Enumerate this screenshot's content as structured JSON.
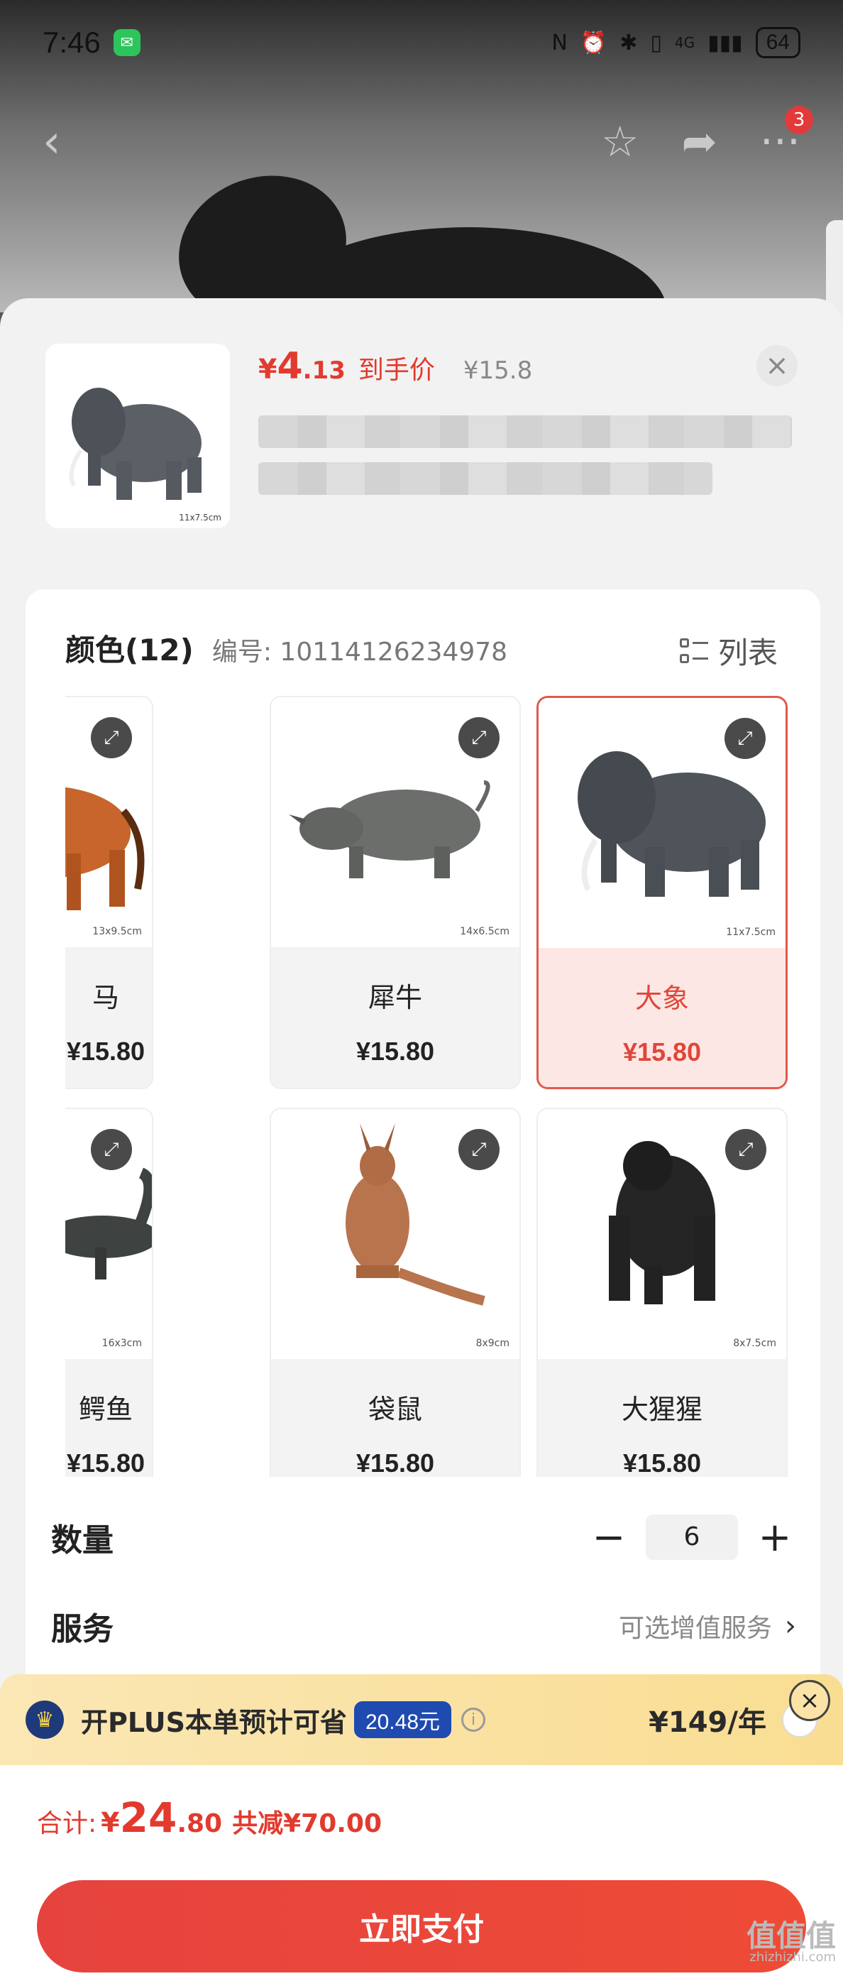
{
  "status": {
    "time": "7:46",
    "battery": "64",
    "network": "4G"
  },
  "nav": {
    "more_badge": "3"
  },
  "product": {
    "price_symbol": "¥",
    "price_int": "4",
    "price_dec": ".13",
    "price_tag": "到手价",
    "orig_price": "¥15.8",
    "thumb_size": "11x7.5cm"
  },
  "variants": {
    "title": "颜色(12)",
    "code_label": "编号: 10114126234978",
    "list_toggle": "列表",
    "items": [
      {
        "name": "马",
        "price": "¥15.80",
        "size": "13x9.5cm",
        "selected": false
      },
      {
        "name": "犀牛",
        "price": "¥15.80",
        "size": "14x6.5cm",
        "selected": false
      },
      {
        "name": "大象",
        "price": "¥15.80",
        "size": "11x7.5cm",
        "selected": true
      },
      {
        "name": "鳄鱼",
        "price": "¥15.80",
        "size": "16x3cm",
        "selected": false
      },
      {
        "name": "袋鼠",
        "price": "¥15.80",
        "size": "8x9cm",
        "selected": false
      },
      {
        "name": "大猩猩",
        "price": "¥15.80",
        "size": "8x7.5cm",
        "selected": false
      }
    ]
  },
  "quantity": {
    "label": "数量",
    "value": "6",
    "minus": "−",
    "plus": "+"
  },
  "service": {
    "label": "服务",
    "option": "可选增值服务",
    "chevron": "›"
  },
  "plus": {
    "text": "开PLUS本单预计可省",
    "save": "20.48元",
    "price": "¥149/年",
    "info": "i",
    "close": "×"
  },
  "footer": {
    "total_label": "合计:",
    "total_symbol": "¥",
    "total_int": "24",
    "total_dec": ".80",
    "discount": "共减¥70.00",
    "pay": "立即支付",
    "watermark": "值值值",
    "watermark_sub": "zhizhizhi.com"
  },
  "colors": {
    "accent": "#e23a2e",
    "plus_blue": "#1f4bb0",
    "selected_bg": "#fde7e4"
  }
}
